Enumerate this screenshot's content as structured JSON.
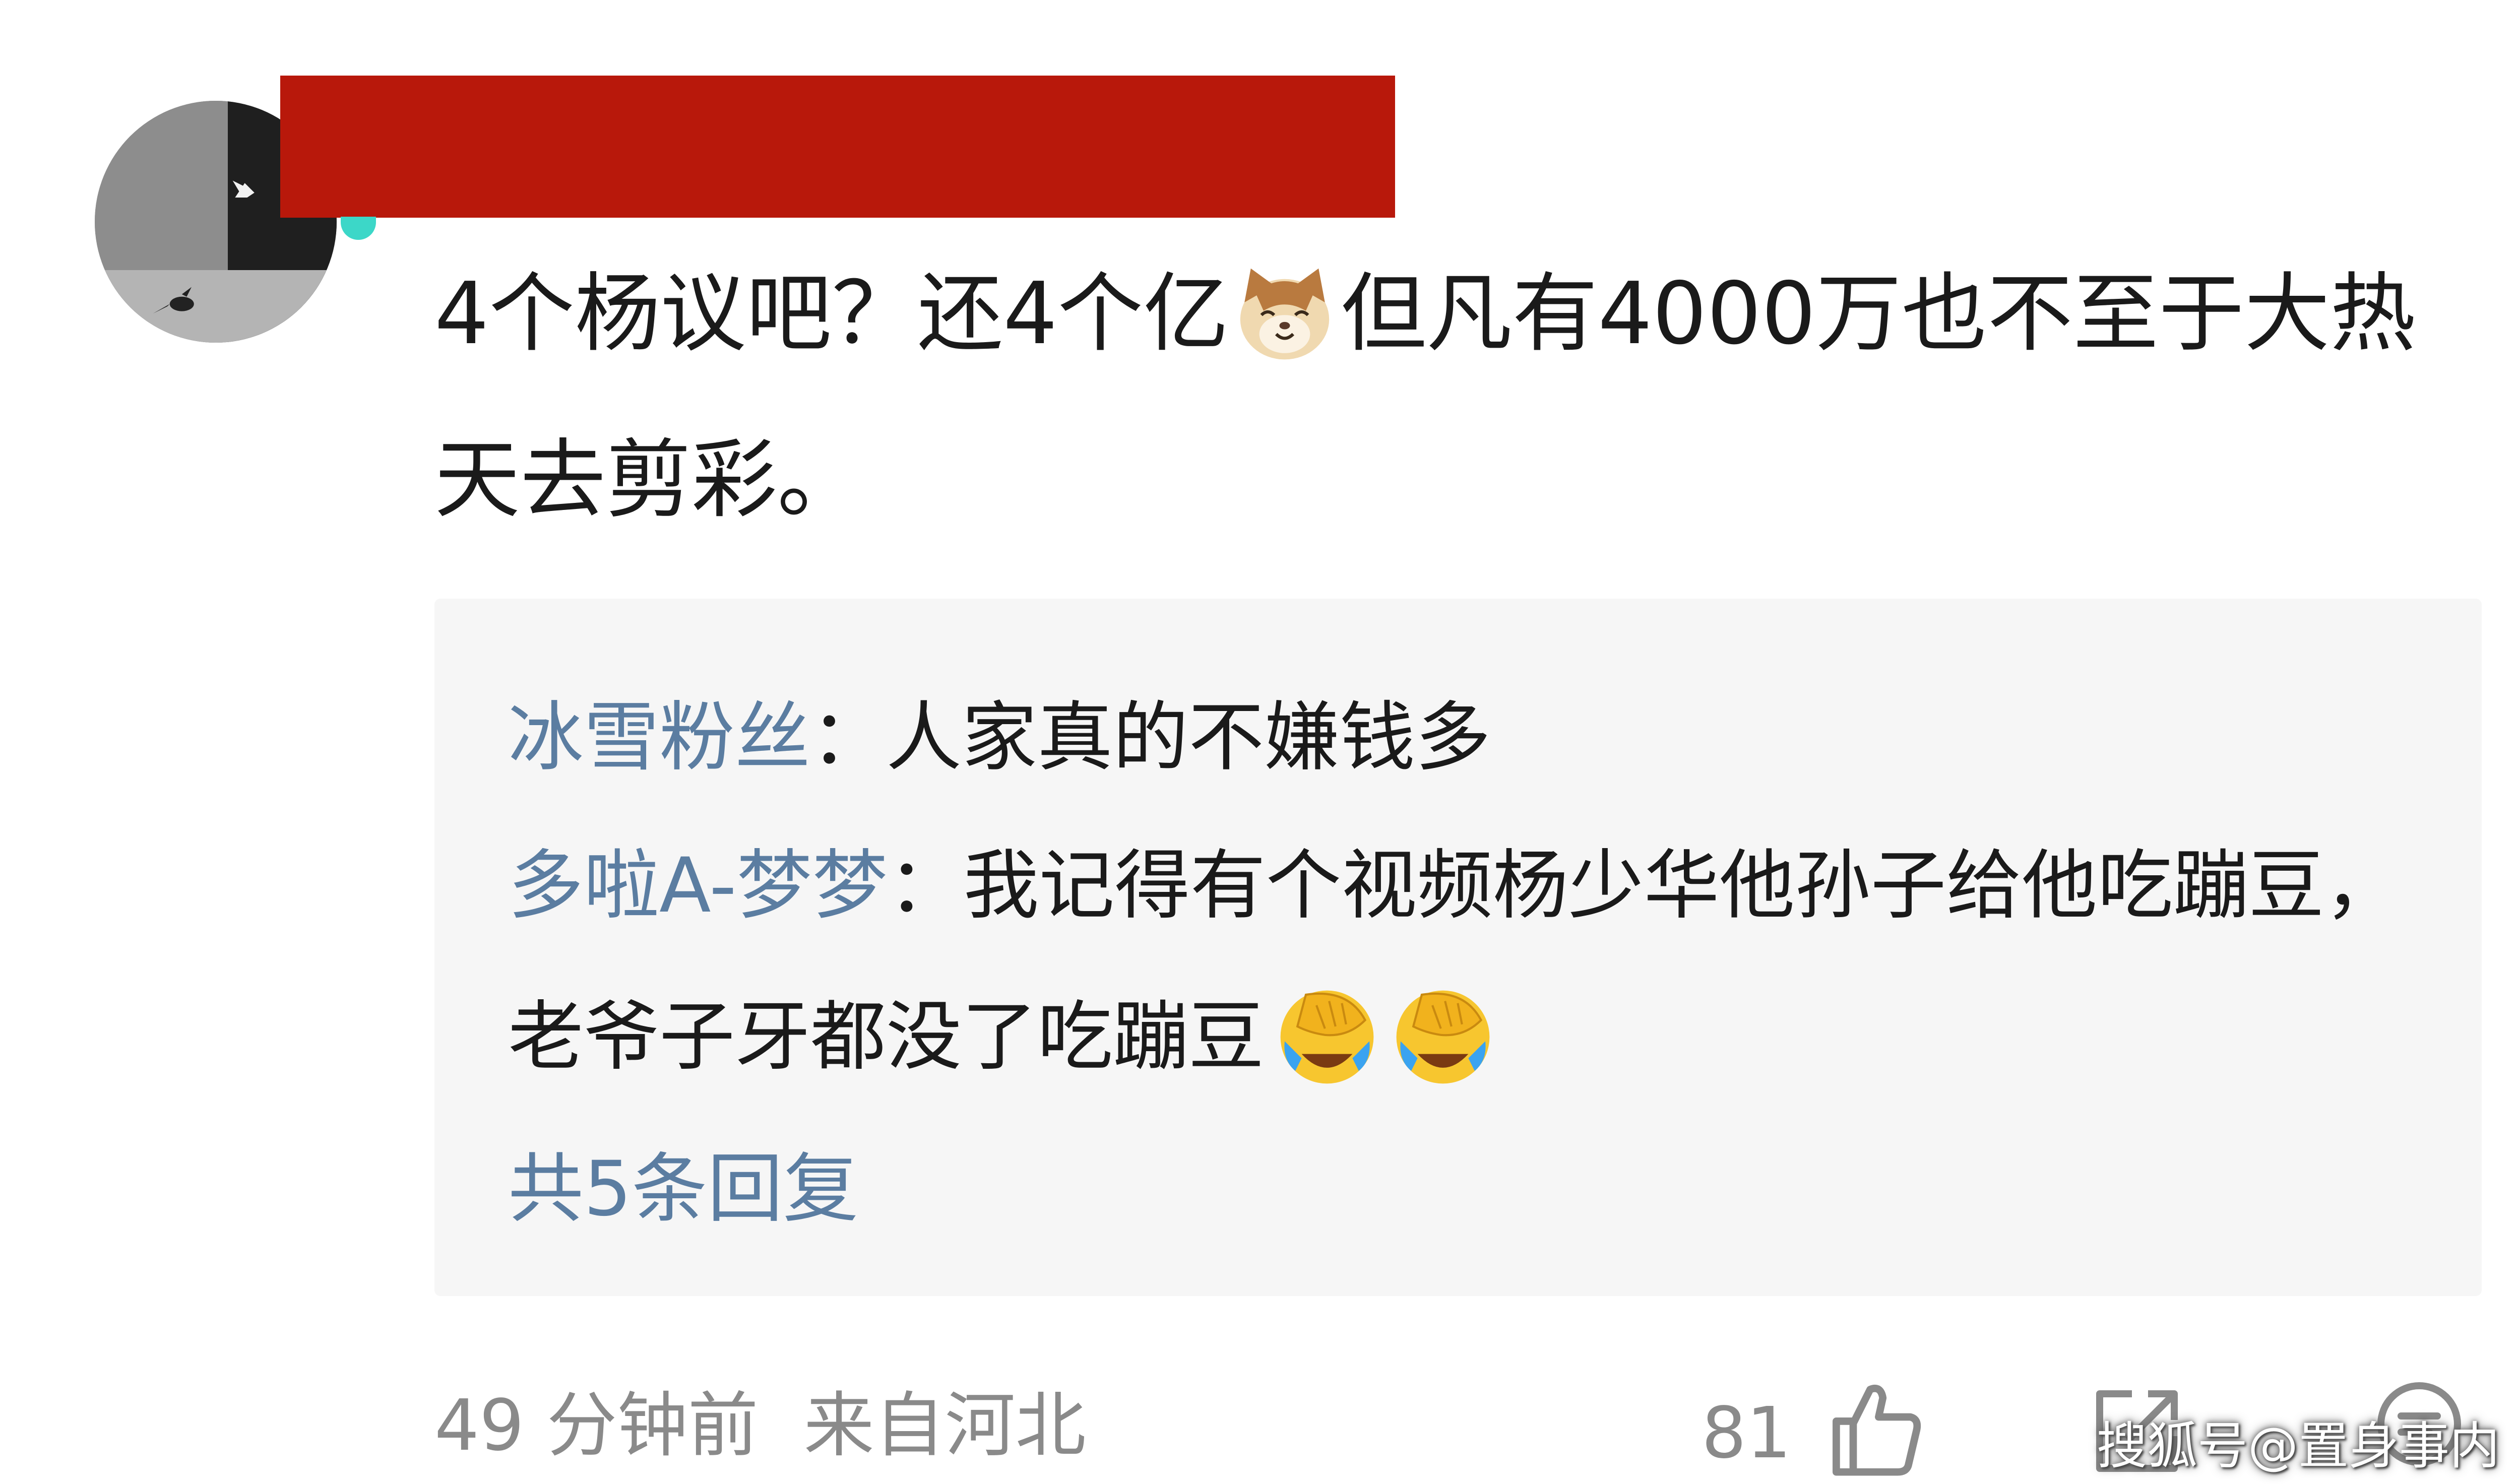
{
  "comment": {
    "text_before_emoji": "4个杨议吧？还4个亿",
    "emoji": "cat-face-emoji",
    "text_after_emoji": "但凡有4000万也不至于大热天去剪彩。"
  },
  "replies": [
    {
      "user": "冰雪粉丝",
      "separator": "：",
      "text": "人家真的不嫌钱多"
    },
    {
      "user": "多啦A-梦梦",
      "separator": "：",
      "text": "我记得有个视频杨少华他孙子给他吃蹦豆，老爷子牙都没了吃蹦豆",
      "emojis": [
        "facepalm-laugh-emoji",
        "facepalm-laugh-emoji"
      ]
    }
  ],
  "more_replies_label": "共5条回复",
  "footer": {
    "time": "49 分钟前",
    "location": "来自河北",
    "like_count": "81"
  },
  "icons": {
    "like": "thumbs-up-icon",
    "share": "share-icon",
    "comment": "comment-icon"
  },
  "watermark": "搜狐号@置身事内",
  "colors": {
    "redaction": "#b8180b",
    "username": "#5b7da1",
    "reply_box_bg": "#f6f6f6",
    "meta_text": "#8a8a8a"
  }
}
